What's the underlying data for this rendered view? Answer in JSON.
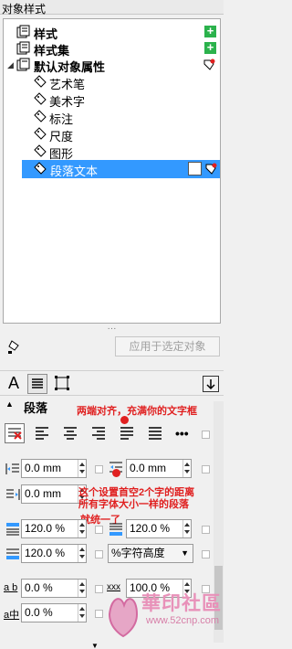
{
  "header": {
    "title": "对象样式"
  },
  "tree": {
    "items": [
      {
        "label": "样式",
        "bold": true
      },
      {
        "label": "样式集",
        "bold": true
      },
      {
        "label": "默认对象属性",
        "bold": true
      },
      {
        "label": "艺术笔"
      },
      {
        "label": "美术字"
      },
      {
        "label": "标注"
      },
      {
        "label": "尺度"
      },
      {
        "label": "图形"
      },
      {
        "label": "段落文本",
        "selected": true
      }
    ]
  },
  "apply": {
    "label": "应用于选定对象"
  },
  "paragraph": {
    "section_title": "段落",
    "annotation_top": "两端对齐，充满你的文字框",
    "annotation_mid_1": "这个设置首空2个字的距离",
    "annotation_mid_2": "所有字体大小一样的段落",
    "annotation_mid_3": "就统一了",
    "indent_first": "0.0 mm",
    "indent_left": "0.0 mm",
    "indent_left2": "0.0 mm",
    "indent_right": "0.0 mm",
    "spacing_before": "120.0 %",
    "spacing_after": "120.0 %",
    "line_spacing": "120.0 %",
    "line_spacing_unit": "%字符高度",
    "char_spacing": "0.0 %",
    "word_spacing": "100.0 %",
    "lang_spacing": "0.0 %"
  },
  "watermark": {
    "brand": "華印社區",
    "url": "www.52cnp.com"
  },
  "colors": {
    "accent": "#3399ff",
    "plus": "#2bb24c",
    "note": "#e02020"
  }
}
